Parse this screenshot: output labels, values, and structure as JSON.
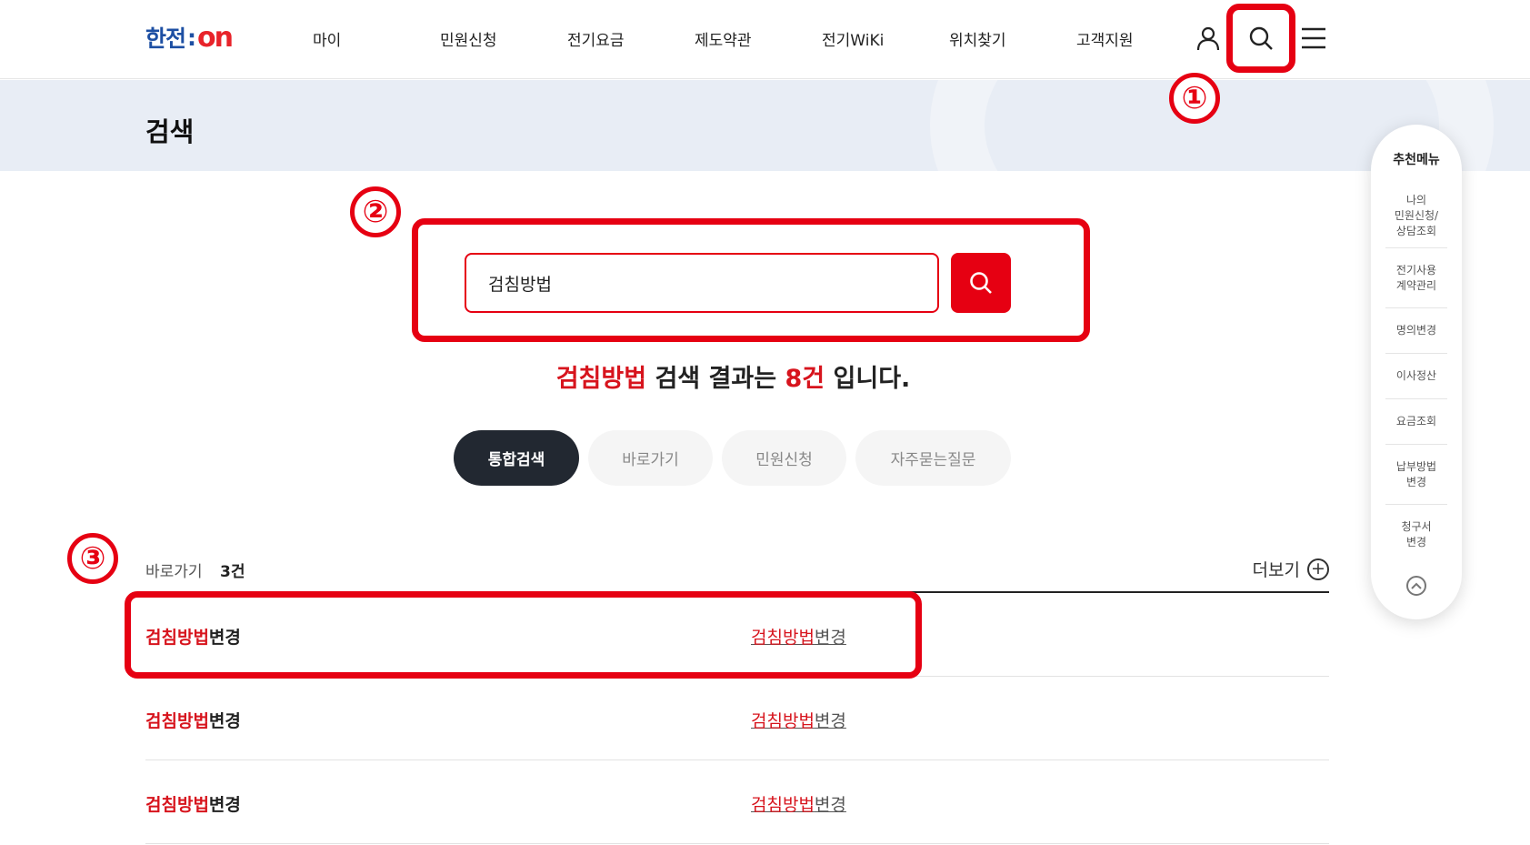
{
  "header": {
    "logo": {
      "part1": "한전",
      "separator": ":",
      "part2": "on"
    },
    "nav": [
      "마이",
      "민원신청",
      "전기요금",
      "제도약관",
      "전기WiKi",
      "위치찾기",
      "고객지원"
    ],
    "icons": [
      "user-icon",
      "search-icon",
      "menu-icon"
    ]
  },
  "page": {
    "title": "검색"
  },
  "search": {
    "value": "검침방법",
    "placeholder": ""
  },
  "result_summary": {
    "keyword": "검침방법",
    "mid": " 검색 결과는 ",
    "count": "8건",
    "end": " 입니다."
  },
  "tabs": [
    {
      "label": "통합검색",
      "active": true
    },
    {
      "label": "바로가기",
      "active": false
    },
    {
      "label": "민원신청",
      "active": false
    },
    {
      "label": "자주묻는질문",
      "active": false
    }
  ],
  "section": {
    "label": "바로가기",
    "count": "3건",
    "more": "더보기"
  },
  "results": [
    {
      "title_highlight": "검침방법",
      "title_rest": "변경",
      "link_highlight": "검침방법",
      "link_rest": "변경"
    },
    {
      "title_highlight": "검침방법",
      "title_rest": "변경",
      "link_highlight": "검침방법",
      "link_rest": "변경"
    },
    {
      "title_highlight": "검침방법",
      "title_rest": "변경",
      "link_highlight": "검침방법",
      "link_rest": "변경"
    }
  ],
  "quick_menu": {
    "title": "추천메뉴",
    "items": [
      "나의\n민원신청/\n상담조회",
      "전기사용\n계약관리",
      "명의변경",
      "이사정산",
      "요금조회",
      "납부방법\n변경",
      "청구서\n변경"
    ]
  },
  "annotations": [
    "①",
    "②",
    "③"
  ],
  "colors": {
    "accent": "#e60012",
    "highlight_text": "#d7141d",
    "brand_blue": "#1d4fa3",
    "active_tab": "#222831"
  }
}
